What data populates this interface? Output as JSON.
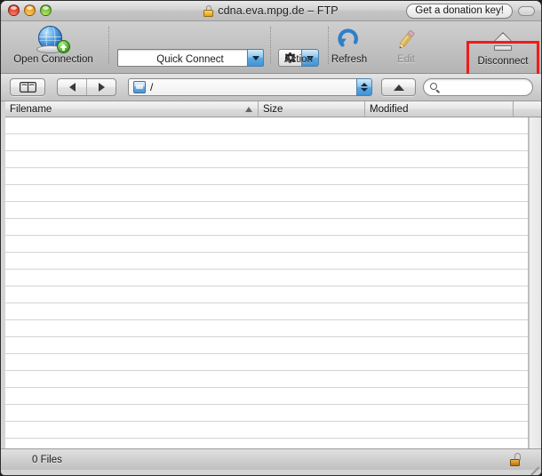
{
  "window": {
    "title": "cdna.eva.mpg.de – FTP",
    "title_lock_icon": "lock-icon",
    "traffic_lights": [
      {
        "name": "close",
        "color": "#e8493a"
      },
      {
        "name": "minimize",
        "color": "#f2a62a"
      },
      {
        "name": "zoom",
        "color": "#7fc83a"
      }
    ],
    "donation_button": "Get a donation key!",
    "toolbar_toggle_icon": "toolbar-toggle-icon"
  },
  "toolbar": {
    "open_connection": {
      "label": "Open Connection",
      "icon": "globe-add-icon"
    },
    "quick_connect": {
      "label": "Quick Connect",
      "value": "",
      "placeholder": "",
      "dropdown_icon": "chevron-down-icon"
    },
    "action": {
      "label": "Action",
      "icon": "gear-icon",
      "dropdown_icon": "chevron-down-icon"
    },
    "refresh": {
      "label": "Refresh",
      "icon": "refresh-icon"
    },
    "edit": {
      "label": "Edit",
      "icon": "pencil-icon",
      "disabled": true
    },
    "disconnect": {
      "label": "Disconnect",
      "icon": "eject-icon",
      "highlighted": true
    },
    "highlight_color": "#ee1c1c"
  },
  "navbar": {
    "bookmarks_icon": "book-icon",
    "back_icon": "triangle-left-icon",
    "forward_icon": "triangle-right-icon",
    "path": {
      "value": "/",
      "volume_icon": "disk-icon",
      "stepper_icon": "stepper-updown-icon"
    },
    "parent_dir_icon": "triangle-up-icon",
    "search": {
      "value": "",
      "placeholder": "",
      "icon": "search-icon"
    }
  },
  "columns": [
    {
      "label": "Filename",
      "sorted": "ascending",
      "sort_icon": "triangle-up-icon"
    },
    {
      "label": "Size",
      "sorted": ""
    },
    {
      "label": "Modified",
      "sorted": ""
    }
  ],
  "file_list": {
    "rows": [],
    "empty": true,
    "visible_row_count": 20
  },
  "statusbar": {
    "text": "0 Files",
    "lock_icon": "unlocked-padlock-icon",
    "resize_grip_icon": "resize-grip-icon"
  }
}
